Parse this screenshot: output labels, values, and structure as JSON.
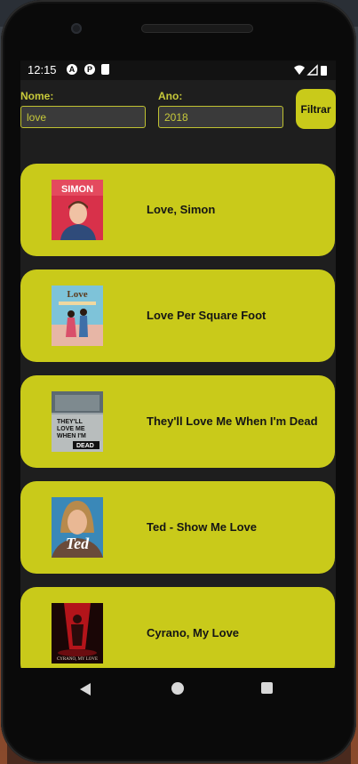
{
  "status_bar": {
    "time": "12:15",
    "icons": [
      "vpn-a-icon",
      "p-badge-icon",
      "sd-card-icon",
      "wifi-icon",
      "signal-icon",
      "battery-icon"
    ]
  },
  "filter": {
    "name_label": "Nome:",
    "name_value": "love",
    "year_label": "Ano:",
    "year_value": "2018",
    "button_label": "Filtrar"
  },
  "movies": [
    {
      "title": "Love, Simon",
      "poster": "love-simon-poster"
    },
    {
      "title": "Love Per Square Foot",
      "poster": "love-per-square-foot-poster"
    },
    {
      "title": "They'll Love Me When I'm Dead",
      "poster": "theyll-love-me-when-im-dead-poster"
    },
    {
      "title": "Ted - Show Me Love",
      "poster": "ted-show-me-love-poster"
    },
    {
      "title": "Cyrano, My Love",
      "poster": "cyrano-my-love-poster"
    }
  ],
  "poster_text": {
    "p0": "SIMON",
    "p1": "Love",
    "p2a": "THEY'LL",
    "p2b": "LOVE ME",
    "p2c": "WHEN I'M",
    "p2d": "DEAD",
    "p3": "Ted",
    "p4": "CYRANO, MY LOVE"
  },
  "colors": {
    "accent": "#c9ca1a",
    "label": "#c7c93a",
    "background": "#1e1e1e",
    "status_bar": "#121212"
  }
}
